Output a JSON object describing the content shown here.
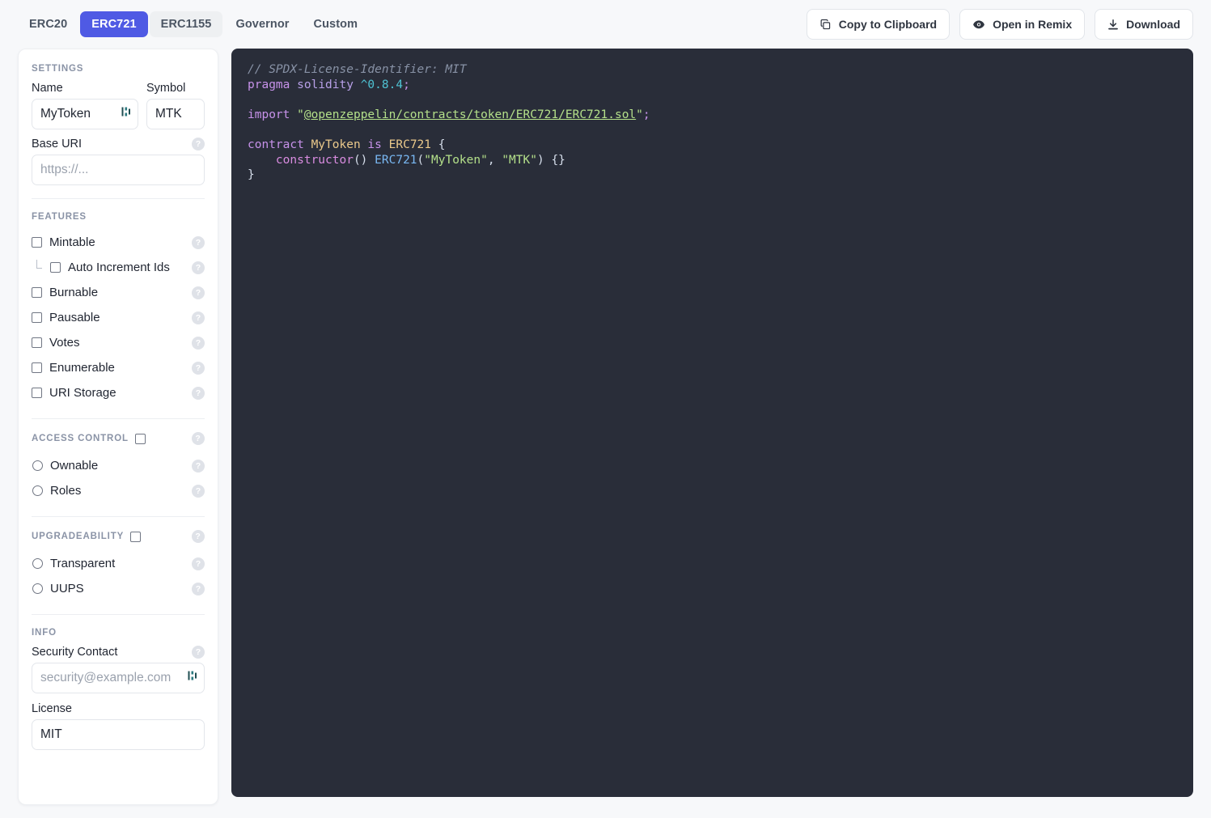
{
  "topbar": {
    "tabs": [
      {
        "label": "ERC20",
        "state": "default"
      },
      {
        "label": "ERC721",
        "state": "active"
      },
      {
        "label": "ERC1155",
        "state": "hover"
      },
      {
        "label": "Governor",
        "state": "default"
      },
      {
        "label": "Custom",
        "state": "default"
      }
    ],
    "actions": [
      {
        "label": "Copy to Clipboard",
        "icon": "copy-icon"
      },
      {
        "label": "Open in Remix",
        "icon": "remix-icon"
      },
      {
        "label": "Download",
        "icon": "download-icon"
      }
    ]
  },
  "sidebar": {
    "settings": {
      "title": "SETTINGS",
      "name_label": "Name",
      "name_value": "MyToken",
      "symbol_label": "Symbol",
      "symbol_value": "MTK",
      "base_uri_label": "Base URI",
      "base_uri_placeholder": "https://...",
      "base_uri_value": ""
    },
    "features": {
      "title": "FEATURES",
      "items": [
        {
          "label": "Mintable",
          "control": "checkbox",
          "checked": false,
          "nested": false,
          "help": "?"
        },
        {
          "label": "Auto Increment Ids",
          "control": "checkbox",
          "checked": false,
          "nested": true,
          "help": "?"
        },
        {
          "label": "Burnable",
          "control": "checkbox",
          "checked": false,
          "nested": false,
          "help": "?"
        },
        {
          "label": "Pausable",
          "control": "checkbox",
          "checked": false,
          "nested": false,
          "help": "?"
        },
        {
          "label": "Votes",
          "control": "checkbox",
          "checked": false,
          "nested": false,
          "help": "?"
        },
        {
          "label": "Enumerable",
          "control": "checkbox",
          "checked": false,
          "nested": false,
          "help": "?"
        },
        {
          "label": "URI Storage",
          "control": "checkbox",
          "checked": false,
          "nested": false,
          "help": "?"
        }
      ]
    },
    "access_control": {
      "title": "ACCESS CONTROL",
      "header_checked": false,
      "items": [
        {
          "label": "Ownable",
          "control": "radio",
          "checked": false,
          "help": "?"
        },
        {
          "label": "Roles",
          "control": "radio",
          "checked": false,
          "help": "?"
        }
      ]
    },
    "upgradeability": {
      "title": "UPGRADEABILITY",
      "header_checked": false,
      "items": [
        {
          "label": "Transparent",
          "control": "radio",
          "checked": false,
          "help": "?"
        },
        {
          "label": "UUPS",
          "control": "radio",
          "checked": false,
          "help": "?"
        }
      ]
    },
    "info": {
      "title": "INFO",
      "security_contact_label": "Security Contact",
      "security_contact_placeholder": "security@example.com",
      "security_contact_value": "",
      "license_label": "License",
      "license_value": "MIT"
    },
    "help_glyph": "?"
  },
  "code": {
    "language": "solidity",
    "lines": [
      "// SPDX-License-Identifier: MIT",
      "pragma solidity ^0.8.4;",
      "",
      "import \"@openzeppelin/contracts/token/ERC721/ERC721.sol\";",
      "",
      "contract MyToken is ERC721 {",
      "    constructor() ERC721(\"MyToken\", \"MTK\") {}",
      "}"
    ]
  },
  "colors": {
    "accent": "#4f5ae4",
    "page_bg": "#f7f8fa",
    "code_bg": "#292d39",
    "comment": "#8892a6",
    "keyword": "#c792ea",
    "string": "#b4e08a",
    "type": "#ebc98b",
    "number": "#4fc3d4",
    "function": "#79b8f3"
  }
}
